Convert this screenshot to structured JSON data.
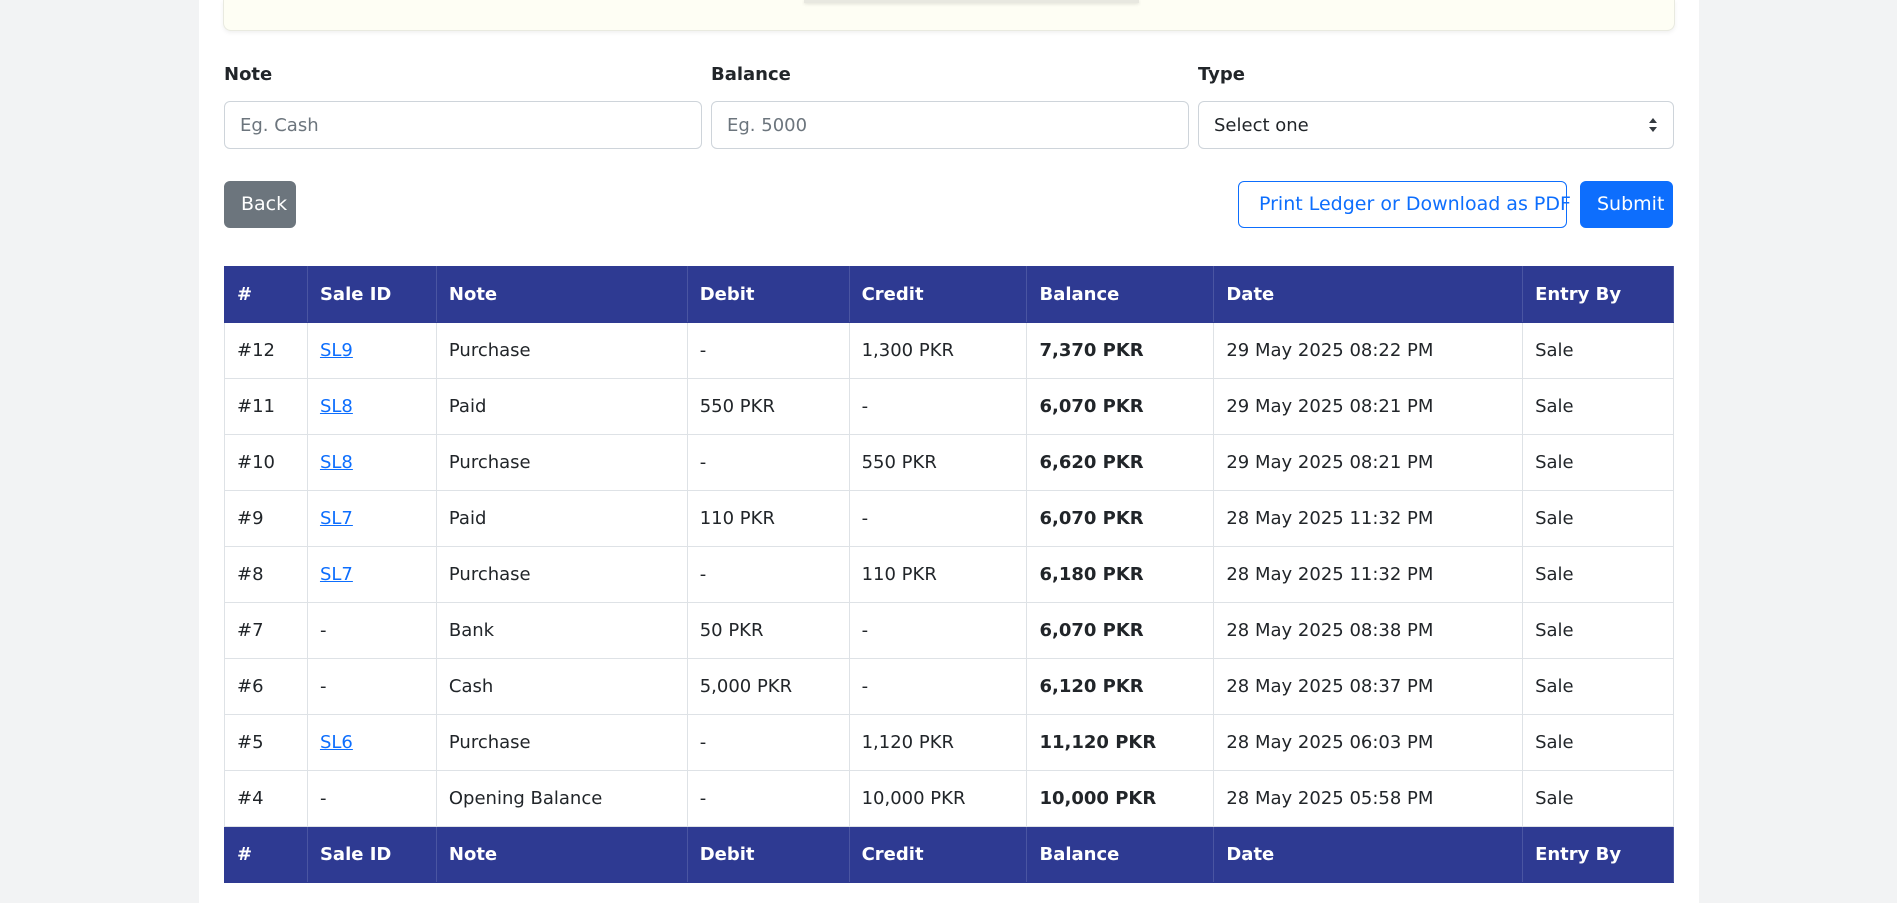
{
  "form": {
    "note": {
      "label": "Note",
      "placeholder": "Eg. Cash"
    },
    "balance": {
      "label": "Balance",
      "placeholder": "Eg. 5000"
    },
    "type": {
      "label": "Type",
      "selected": "Select one"
    }
  },
  "buttons": {
    "back": "Back",
    "print": "Print Ledger or Download as PDF",
    "submit": "Submit"
  },
  "table": {
    "headers": [
      "#",
      "Sale ID",
      "Note",
      "Debit",
      "Credit",
      "Balance",
      "Date",
      "Entry By"
    ],
    "rows": [
      {
        "num": "#12",
        "sale_id": "SL9",
        "note": "Purchase",
        "debit": "-",
        "credit": "1,300 PKR",
        "balance": "7,370 PKR",
        "date": "29 May 2025 08:22 PM",
        "entry_by": "Sale"
      },
      {
        "num": "#11",
        "sale_id": "SL8",
        "note": "Paid",
        "debit": "550 PKR",
        "credit": "-",
        "balance": "6,070 PKR",
        "date": "29 May 2025 08:21 PM",
        "entry_by": "Sale"
      },
      {
        "num": "#10",
        "sale_id": "SL8",
        "note": "Purchase",
        "debit": "-",
        "credit": "550 PKR",
        "balance": "6,620 PKR",
        "date": "29 May 2025 08:21 PM",
        "entry_by": "Sale"
      },
      {
        "num": "#9",
        "sale_id": "SL7",
        "note": "Paid",
        "debit": "110 PKR",
        "credit": "-",
        "balance": "6,070 PKR",
        "date": "28 May 2025 11:32 PM",
        "entry_by": "Sale"
      },
      {
        "num": "#8",
        "sale_id": "SL7",
        "note": "Purchase",
        "debit": "-",
        "credit": "110 PKR",
        "balance": "6,180 PKR",
        "date": "28 May 2025 11:32 PM",
        "entry_by": "Sale"
      },
      {
        "num": "#7",
        "sale_id": "-",
        "note": "Bank",
        "debit": "50 PKR",
        "credit": "-",
        "balance": "6,070 PKR",
        "date": "28 May 2025 08:38 PM",
        "entry_by": "Sale"
      },
      {
        "num": "#6",
        "sale_id": "-",
        "note": "Cash",
        "debit": "5,000 PKR",
        "credit": "-",
        "balance": "6,120 PKR",
        "date": "28 May 2025 08:37 PM",
        "entry_by": "Sale"
      },
      {
        "num": "#5",
        "sale_id": "SL6",
        "note": "Purchase",
        "debit": "-",
        "credit": "1,120 PKR",
        "balance": "11,120 PKR",
        "date": "28 May 2025 06:03 PM",
        "entry_by": "Sale"
      },
      {
        "num": "#4",
        "sale_id": "-",
        "note": "Opening Balance",
        "debit": "-",
        "credit": "10,000 PKR",
        "balance": "10,000 PKR",
        "date": "28 May 2025 05:58 PM",
        "entry_by": "Sale"
      }
    ]
  },
  "colors": {
    "header_bg": "#2e3a92",
    "primary": "#0d6efd",
    "secondary": "#6c757d"
  },
  "icons": {
    "print": "printer-icon",
    "select": "sort-caret-icon"
  }
}
